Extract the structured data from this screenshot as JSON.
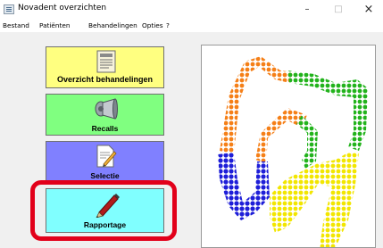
{
  "window": {
    "title": "Novadent overzichten",
    "controls": {
      "minimize": "–",
      "maximize": "□",
      "close": "×"
    }
  },
  "menu": [
    "Bestand",
    "Patiënten",
    "Behandelingen",
    "Opties",
    "?"
  ],
  "buttons": [
    {
      "label": "Overzicht behandelingen",
      "color": "#ffff80",
      "icon": "document-icon"
    },
    {
      "label": "Recalls",
      "color": "#80ff80",
      "icon": "megaphone-icon"
    },
    {
      "label": "Selectie",
      "color": "#8080ff",
      "icon": "edit-document-icon"
    },
    {
      "label": "Rapportage",
      "color": "#80ffff",
      "icon": "pen-icon"
    }
  ],
  "highlight_color": "#e2001a",
  "logo": {
    "description_colors": [
      "#f57f17",
      "#22b31c",
      "#1e1ed8",
      "#f2e600"
    ],
    "icon": "tooth-logo-icon"
  }
}
